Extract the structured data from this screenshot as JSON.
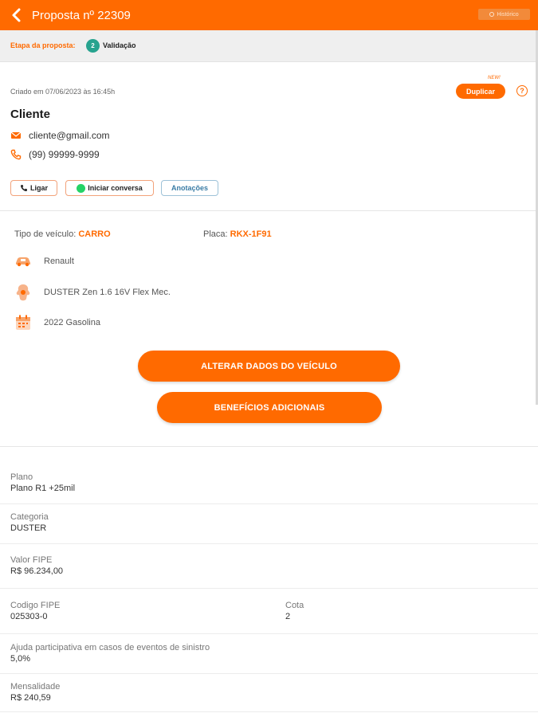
{
  "header": {
    "title": "Proposta nº 22309",
    "history_label": "Histórico"
  },
  "stage": {
    "label": "Etapa da proposta:",
    "number": "2",
    "name": "Validação"
  },
  "client": {
    "created": "Criado em 07/06/2023 às 16:45h",
    "new_tag": "NEW!",
    "duplicate_label": "Duplicar",
    "help_label": "?",
    "name": "Cliente",
    "email": "cliente@gmail.com",
    "phone": "(99) 99999-9999",
    "actions": {
      "call": "Ligar",
      "chat": "Iniciar conversa",
      "notes": "Anotações"
    }
  },
  "vehicle": {
    "type_label": "Tipo de veículo:",
    "type_value": "CARRO",
    "plate_label": "Placa:",
    "plate_value": "RKX-1F91",
    "brand": "Renault",
    "model": "DUSTER Zen 1.6 16V Flex Mec.",
    "year_fuel": "2022 Gasolina",
    "icons": [
      "car-icon",
      "model-icon",
      "calendar-icon"
    ]
  },
  "buttons": {
    "change_vehicle": "ALTERAR DADOS DO VEÍCULO",
    "extra_benefits": "BENEFÍCIOS ADICIONAIS"
  },
  "details": {
    "plan_label": "Plano",
    "plan_value": "Plano R1 +25mil",
    "category_label": "Categoria",
    "category_value": "DUSTER",
    "fipe_value_label": "Valor FIPE",
    "fipe_value": "R$ 96.234,00",
    "fipe_code_label": "Codigo FIPE",
    "fipe_code": "025303-0",
    "quota_label": "Cota",
    "quota_value": "2",
    "participation_label": "Ajuda participativa em casos de eventos de sinistro",
    "participation_value": "5,0%",
    "monthly_label": "Mensalidade",
    "monthly_value": "R$ 240,59"
  },
  "colors": {
    "primary": "#ff6a00",
    "stage_badge": "#27a38f",
    "stage_bg": "#efefef",
    "whatsapp": "#25d366",
    "notes_border": "#9dc2d8"
  }
}
